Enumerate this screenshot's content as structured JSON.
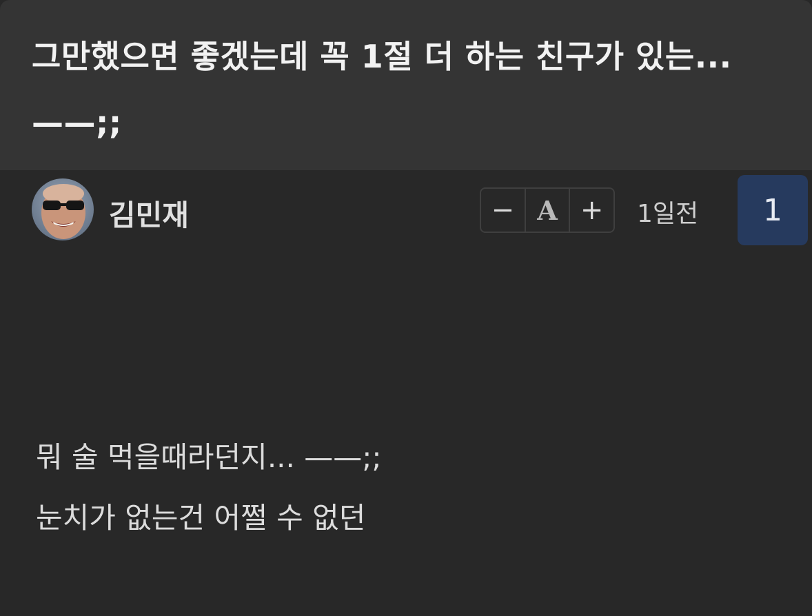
{
  "post": {
    "title": "그만했으면 좋겠는데 꼭 1절 더 하는 친구가 있는... ——;;",
    "author": "김민재",
    "time": "1일전",
    "comment_count": "1",
    "font_controls": {
      "decrease": "−",
      "reset": "A",
      "increase": "+"
    },
    "body": [
      "뭐 술 먹을때라던지... ——;;",
      "눈치가 없는건 어쩔 수 없던"
    ]
  },
  "colors": {
    "background": "#282828",
    "title_bar": "#343434",
    "comment_badge": "#263a5e"
  },
  "icons": {
    "avatar": "profile-photo"
  }
}
